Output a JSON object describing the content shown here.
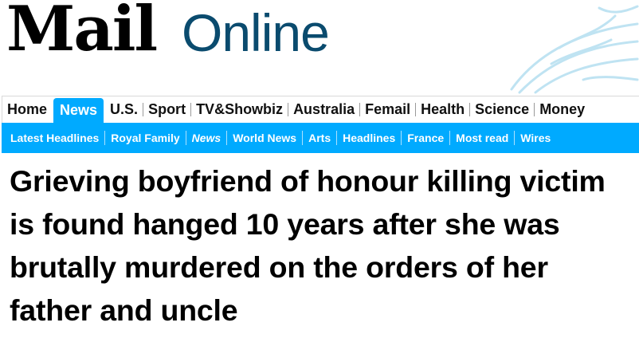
{
  "masthead": {
    "logo_mail": "Mail",
    "logo_online": "Online"
  },
  "primary_nav": {
    "items": [
      {
        "label": "Home",
        "active": false
      },
      {
        "label": "News",
        "active": true
      },
      {
        "label": "U.S.",
        "active": false
      },
      {
        "label": "Sport",
        "active": false
      },
      {
        "label": "TV&Showbiz",
        "active": false
      },
      {
        "label": "Australia",
        "active": false
      },
      {
        "label": "Femail",
        "active": false
      },
      {
        "label": "Health",
        "active": false
      },
      {
        "label": "Science",
        "active": false
      },
      {
        "label": "Money",
        "active": false
      }
    ]
  },
  "secondary_nav": {
    "items": [
      {
        "label": "Latest Headlines"
      },
      {
        "label": "Royal Family"
      },
      {
        "label": "News"
      },
      {
        "label": "World News"
      },
      {
        "label": "Arts"
      },
      {
        "label": "Headlines"
      },
      {
        "label": "France"
      },
      {
        "label": "Most read"
      },
      {
        "label": "Wires"
      }
    ]
  },
  "article": {
    "headline": "Grieving boyfriend of honour killing victim is found hanged 10 years after she was brutally murdered on the orders of her father and uncle"
  },
  "colors": {
    "accent": "#00aaff",
    "online_text": "#0a4b6e",
    "wave_art": "#bfe3f2"
  }
}
